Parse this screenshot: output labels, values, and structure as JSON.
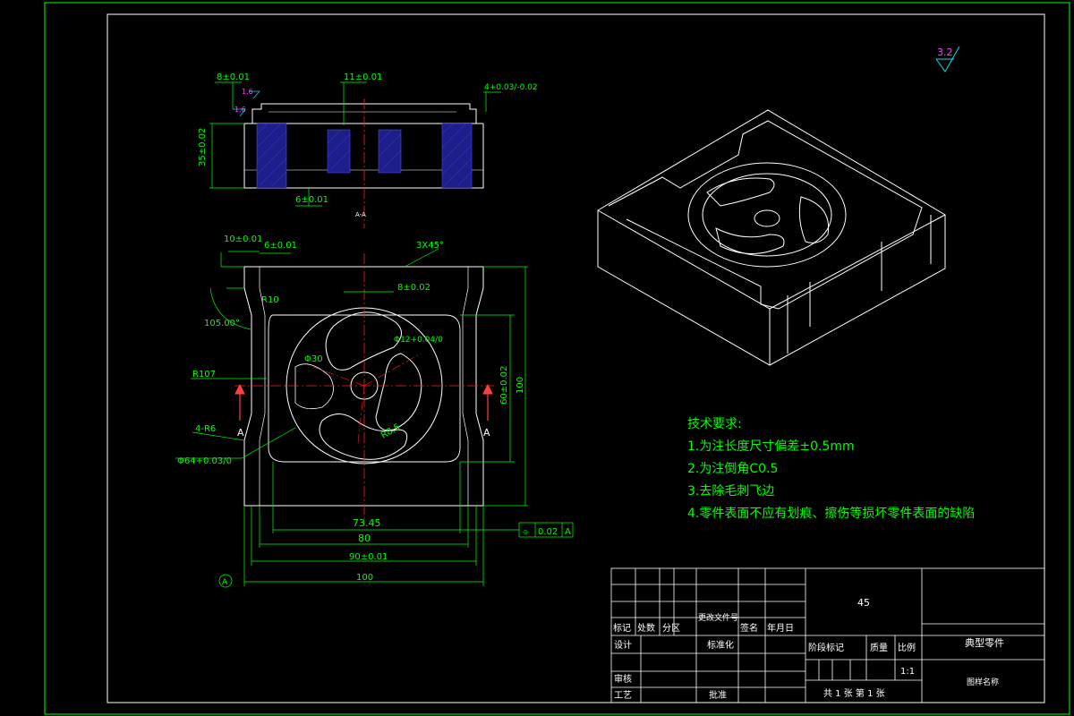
{
  "roughness": {
    "main": "3.2",
    "side_a": "1.6",
    "side_b": "1.6"
  },
  "section": {
    "label": "A-A",
    "dims": {
      "top_left": "8±0.01",
      "top_mid": "11±0.01",
      "right_top": "4+0.03/-0.02",
      "height": "35±0.02",
      "bottom": "6±0.01"
    }
  },
  "plan": {
    "dims": {
      "d10": "10±0.01",
      "d6": "6±0.01",
      "chamfer": "3X45°",
      "d8": "8±0.02",
      "angle": "105.00°",
      "r10": "R10",
      "phi12": "Φ12+0.04/0",
      "phi30": "Φ30",
      "r107": "R107",
      "corner": "4-R6",
      "r85": "R8.5",
      "phi64": "Φ64+0.03/0",
      "h60": "60±0.02",
      "h100": "100",
      "w7345": "73.45",
      "w80": "80",
      "w90": "90±0.01",
      "w100": "100",
      "flatness_sym": "⌯",
      "flatness_val": "0.02",
      "flatness_ref": "A",
      "datum": "A",
      "sec_left": "A",
      "sec_right": "A"
    }
  },
  "notes": {
    "title": "技术要求:",
    "items": [
      "1.为注长度尺寸偏差±0.5mm",
      "2.为注倒角C0.5",
      "3.去除毛刺飞边",
      "4.零件表面不应有划痕、擦伤等损坏零件表面的缺陷"
    ]
  },
  "title_block": {
    "material": "45",
    "part_name": "典型零件",
    "drawing_name": "图样名称",
    "row_labels": [
      "标记",
      "处数",
      "分区",
      "更改文件号",
      "签名",
      "年月日"
    ],
    "design": "设计",
    "standard": "标准化",
    "review": "审核",
    "process": "工艺",
    "approve": "批准",
    "stage_labels": [
      "阶段标记",
      "质量",
      "比例"
    ],
    "scale": "1:1",
    "sheets": "共 1 张 第 1 张"
  },
  "colors": {
    "outline": "#ffffff",
    "dim": "#00ff00",
    "center": "#ff0000",
    "hatch": "#2b2bd6",
    "note": "#00ff00",
    "rough_mag": "#ff40ff"
  }
}
